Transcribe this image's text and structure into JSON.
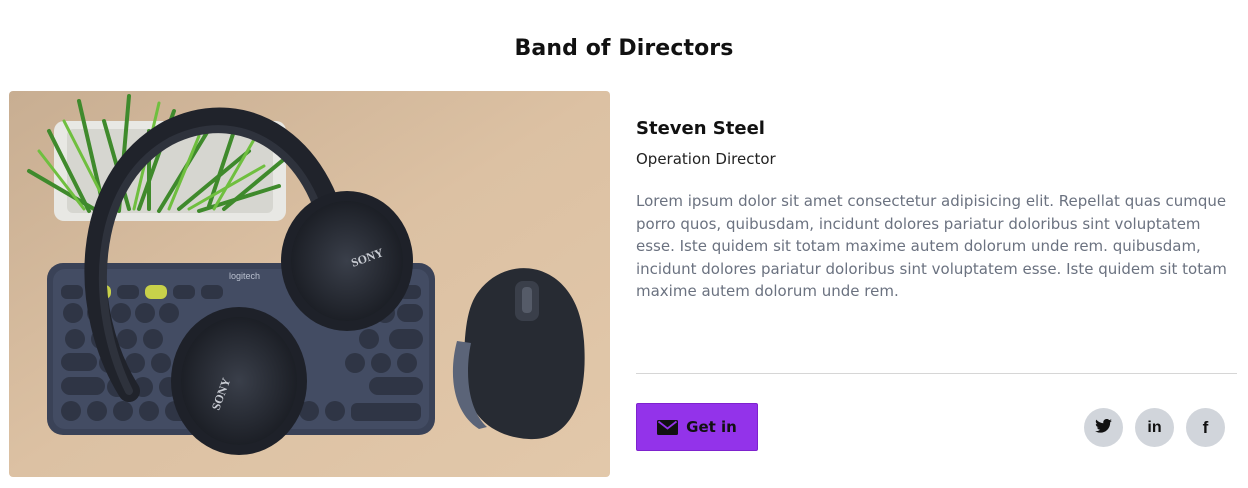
{
  "section": {
    "title": "Band of Directors"
  },
  "photo": {
    "icon": "director-photo",
    "brand_keyboard": "logitech",
    "brand_headphones": "SONY"
  },
  "director": {
    "name": "Steven Steel",
    "role": "Operation Director",
    "bio": "Lorem ipsum dolor sit amet consectetur adipisicing elit. Repellat quas cumque porro quos, quibusdam, incidunt dolores pariatur doloribus sint voluptatem esse. Iste quidem sit totam maxime autem dolorum unde rem. quibusdam, incidunt dolores pariatur doloribus sint voluptatem esse. Iste quidem sit totam maxime autem dolorum unde rem."
  },
  "cta": {
    "label": "Get in",
    "icon": "envelope-icon"
  },
  "social": [
    {
      "name": "twitter",
      "icon": "twitter-icon"
    },
    {
      "name": "linkedin",
      "icon": "linkedin-icon",
      "glyph": "in"
    },
    {
      "name": "facebook",
      "icon": "facebook-icon",
      "glyph": "f"
    }
  ],
  "colors": {
    "accent": "#9333ea",
    "social_bg": "#d1d5db",
    "muted_text": "#6b7280",
    "photo_bg": "#d9bd9c"
  }
}
